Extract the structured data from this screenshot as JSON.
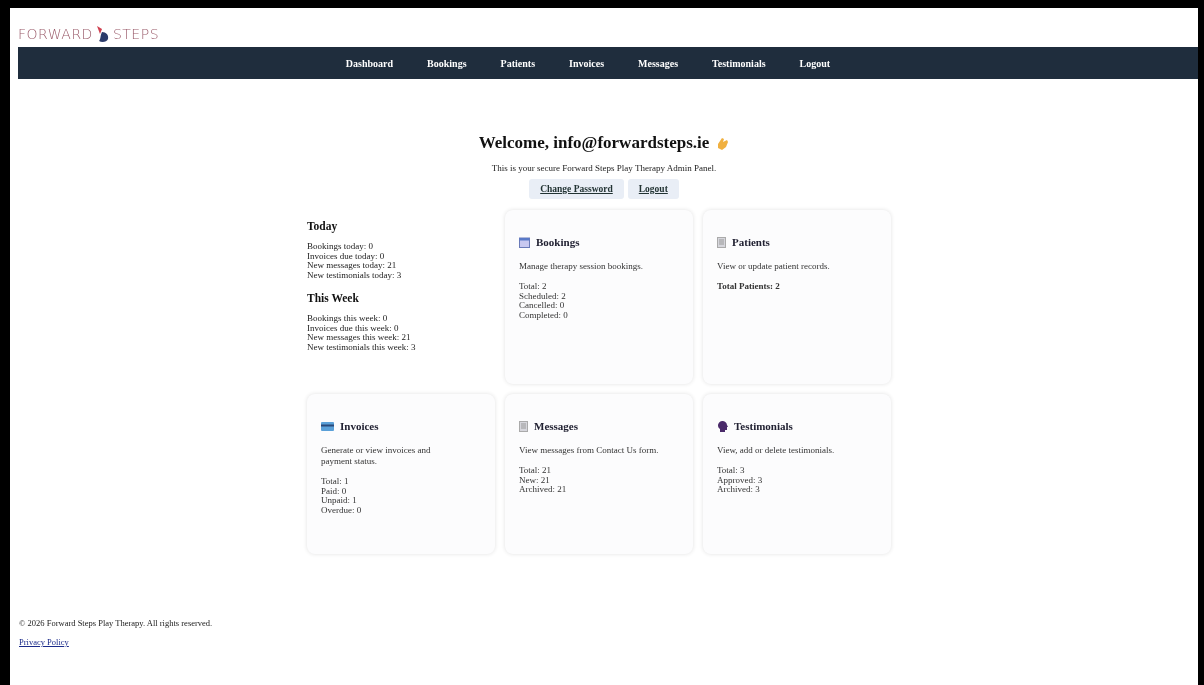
{
  "logo": {
    "left": "FORWARD",
    "right": "STEPS"
  },
  "nav": [
    "Dashboard",
    "Bookings",
    "Patients",
    "Invoices",
    "Messages",
    "Testimonials",
    "Logout"
  ],
  "welcome": {
    "title": "Welcome, info@forwardsteps.ie",
    "subtitle": "This is your secure Forward Steps Play Therapy Admin Panel.",
    "buttons": [
      "Change Password",
      "Logout"
    ]
  },
  "summary": [
    {
      "heading": "Today",
      "lines": [
        "Bookings today: 0",
        "Invoices due today: 0",
        "New messages today: 21",
        "New testimonials today: 3"
      ]
    },
    {
      "heading": "This Week",
      "lines": [
        "Bookings this week: 0",
        "Invoices due this week: 0",
        "New messages this week: 21",
        "New testimonials this week: 3"
      ]
    }
  ],
  "cards": [
    {
      "kind": "calendar",
      "title": "Bookings",
      "description": "Manage therapy session bookings.",
      "bold_stats": false,
      "stats": [
        "Total: 2",
        "Scheduled: 2",
        "Cancelled: 0",
        "Completed: 0"
      ]
    },
    {
      "kind": "document",
      "title": "Patients",
      "description": "View or update patient records.",
      "bold_stats": true,
      "stats": [
        "Total Patients: 2"
      ]
    },
    {
      "kind": "card",
      "title": "Invoices",
      "description": "Generate or view invoices and payment status.",
      "bold_stats": false,
      "stats": [
        "Total: 1",
        "Paid: 0",
        "Unpaid: 1",
        "Overdue: 0"
      ]
    },
    {
      "kind": "document",
      "title": "Messages",
      "description": "View messages from Contact Us form.",
      "bold_stats": false,
      "stats": [
        "Total: 21",
        "New: 21",
        "Archived: 21"
      ]
    },
    {
      "kind": "speech",
      "title": "Testimonials",
      "description": "View, add or delete testimonials.",
      "bold_stats": false,
      "stats": [
        "Total: 3",
        "Approved: 3",
        "Archived: 3"
      ]
    }
  ],
  "footer": {
    "copyright": "© 2026 Forward Steps Play Therapy. All rights reserved.",
    "link": "Privacy Policy"
  }
}
